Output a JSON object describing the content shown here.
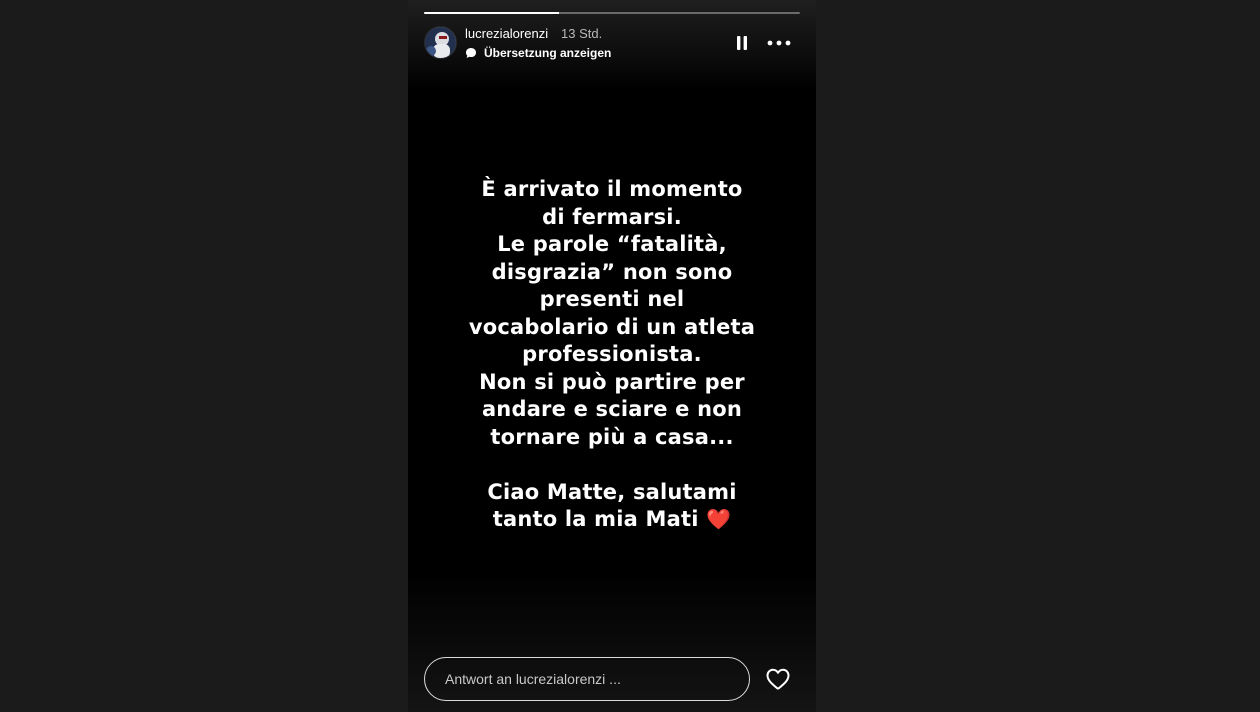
{
  "story": {
    "progress_fraction": 0.36,
    "header": {
      "username": "lucrezialorenzi",
      "time": "13 Std.",
      "translate_label": "Übersetzung anzeigen"
    },
    "text": {
      "lines": [
        "È arrivato il momento",
        "di fermarsi.",
        "Le parole “fatalità,",
        "disgrazia” non sono",
        "presenti nel",
        "vocabolario di un atleta",
        "professionista.",
        "Non si può partire per",
        "andare e sciare e non",
        "tornare più a casa..."
      ],
      "closing_lines": [
        "Ciao Matte, salutami",
        "tanto la mia Mati"
      ],
      "heart_emoji": "❤️"
    },
    "reply": {
      "placeholder": "Antwort an lucrezialorenzi ...",
      "value": ""
    },
    "icons": {
      "pause": "pause-icon",
      "more": "more-options-icon",
      "like": "heart-icon",
      "translate": "speech-bubble-icon"
    }
  }
}
